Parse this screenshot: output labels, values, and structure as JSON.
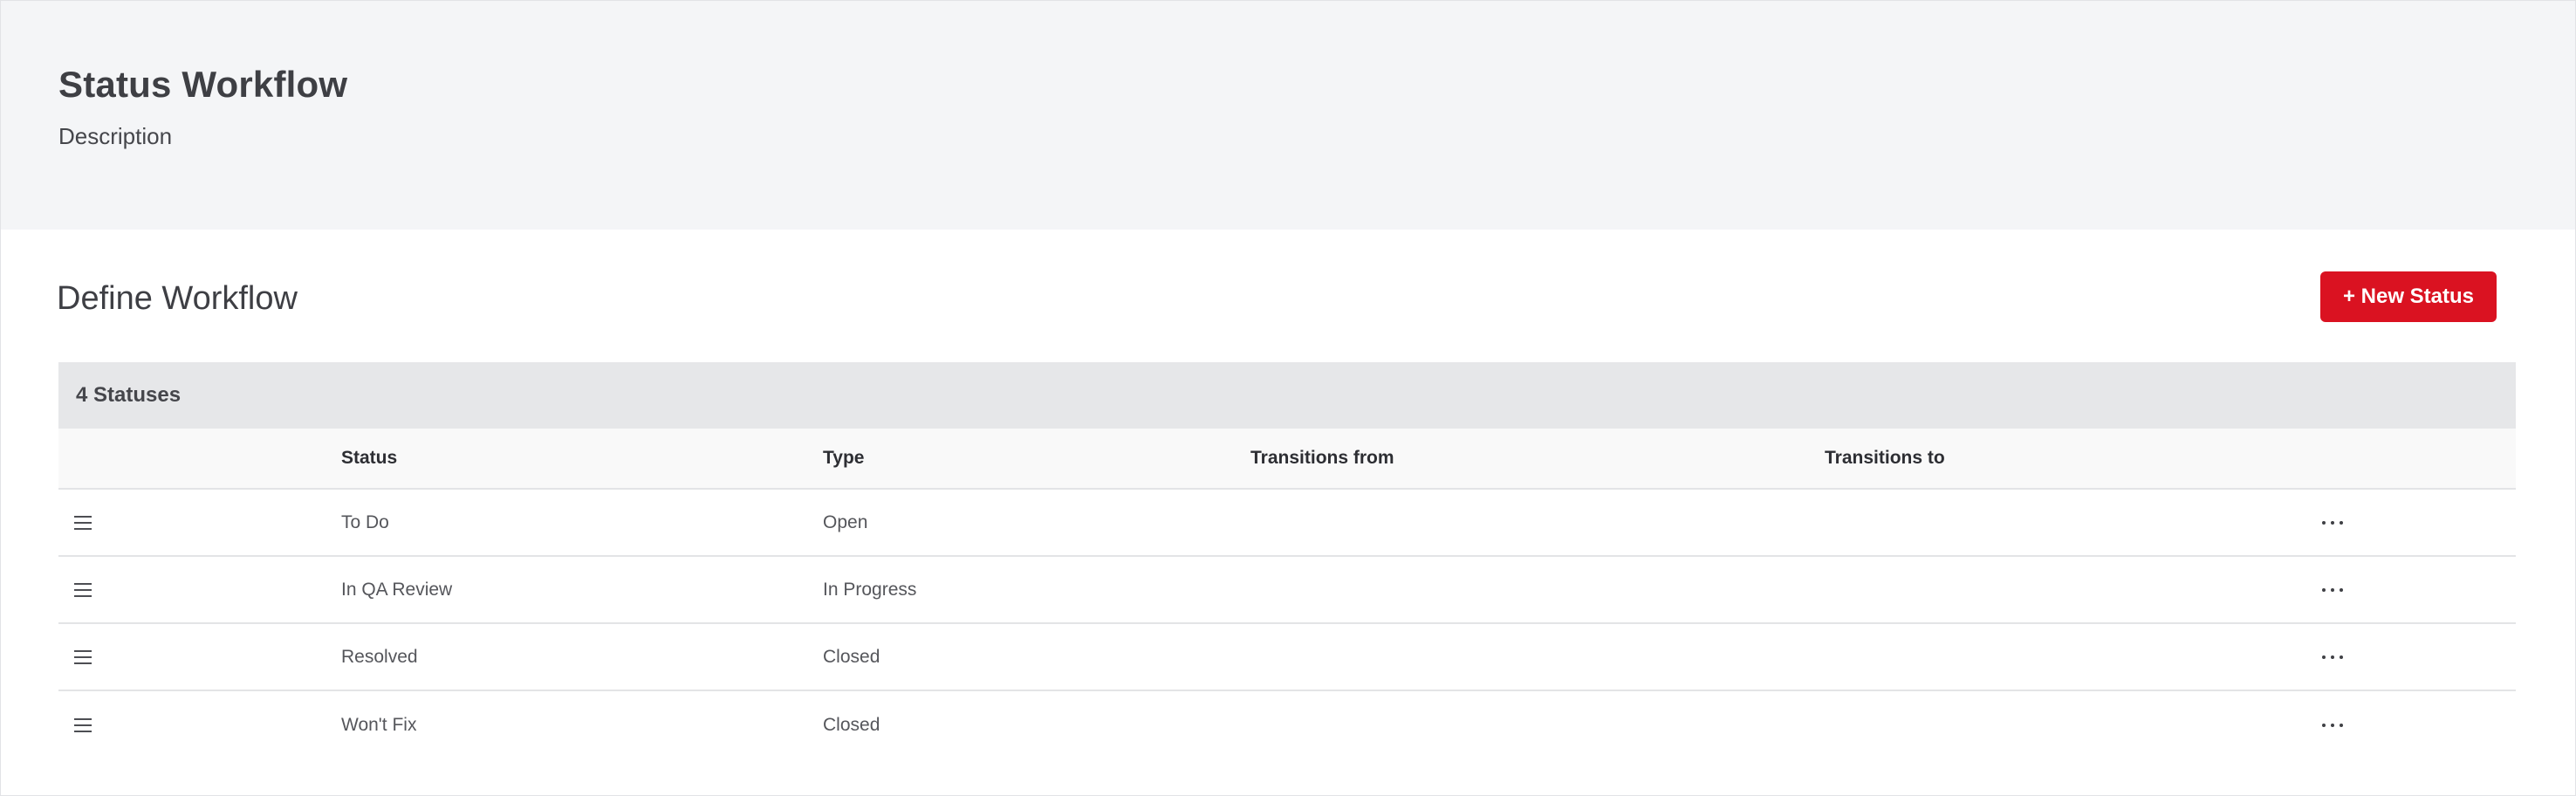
{
  "header": {
    "title": "Status Workflow",
    "description": "Description"
  },
  "main": {
    "section_title": "Define Workflow",
    "new_status_label": "+ New Status"
  },
  "table": {
    "caption": "4 Statuses",
    "columns": {
      "status": "Status",
      "type": "Type",
      "transitions_from": "Transitions from",
      "transitions_to": "Transitions to"
    },
    "rows": [
      {
        "status": "To Do",
        "type": "Open",
        "transitions_from": "",
        "transitions_to": ""
      },
      {
        "status": "In QA Review",
        "type": "In Progress",
        "transitions_from": "",
        "transitions_to": ""
      },
      {
        "status": "Resolved",
        "type": "Closed",
        "transitions_from": "",
        "transitions_to": ""
      },
      {
        "status": "Won't Fix",
        "type": "Closed",
        "transitions_from": "",
        "transitions_to": ""
      }
    ]
  },
  "icons": {
    "drag": "drag-handle-icon",
    "more": "more-horizontal-icon"
  },
  "colors": {
    "accent": "#da1221",
    "header_bg": "#f4f5f7",
    "caption_bg": "#e6e7e9"
  }
}
